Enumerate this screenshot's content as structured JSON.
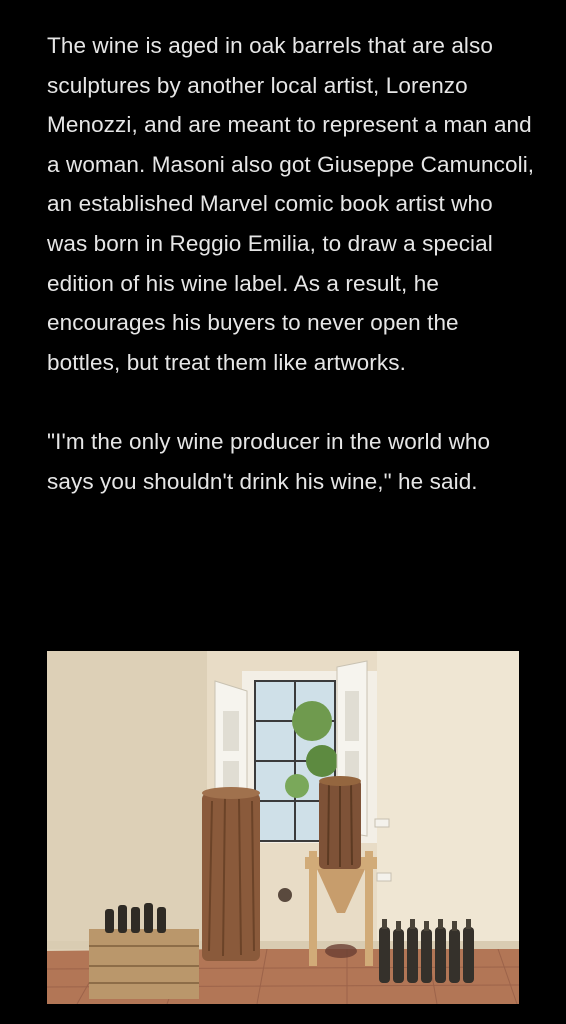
{
  "article": {
    "paragraphs": [
      "The wine is aged in oak barrels that are also sculptures by another local artist, Lorenzo Menozzi, and are meant to represent a man and a woman. Masoni also got Giuseppe Camuncoli, an established Marvel comic book artist who was born in Reggio Emilia, to draw a special edition of his wine label. As a result, he encourages his buyers to never open the bottles, but treat them like artworks.",
      "\"I'm the only wine producer in the world who says you shouldn't drink his wine,\" he said."
    ]
  },
  "photo": {
    "subject": "room-with-wine-barrel-sculptures",
    "colors": {
      "wall": "#eadfc9",
      "floor": "#b07456",
      "wood": "#8a5a3a",
      "bottle": "#2d2a24",
      "crate": "#b9966b"
    }
  }
}
